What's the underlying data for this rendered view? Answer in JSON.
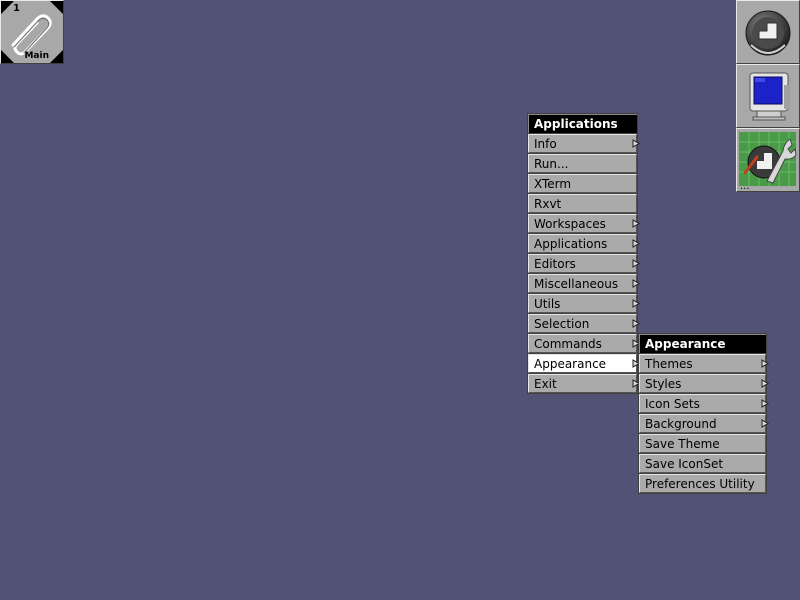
{
  "desktop": {
    "background": "#525275"
  },
  "clip": {
    "workspace_number": "1",
    "workspace_name": "Main",
    "icon": "paperclip-icon"
  },
  "dock": [
    {
      "name": "dock-wmaker-logo",
      "icon": "wmaker-logo-icon"
    },
    {
      "name": "dock-monitor",
      "icon": "monitor-icon"
    },
    {
      "name": "dock-wprefs",
      "icon": "preferences-wrench-icon",
      "ellipsis": "..."
    }
  ],
  "applications_menu": {
    "title": "Applications",
    "items": [
      {
        "label": "Info",
        "submenu": true
      },
      {
        "label": "Run...",
        "submenu": false
      },
      {
        "label": "XTerm",
        "submenu": false
      },
      {
        "label": "Rxvt",
        "submenu": false
      },
      {
        "label": "Workspaces",
        "submenu": true
      },
      {
        "label": "Applications",
        "submenu": true
      },
      {
        "label": "Editors",
        "submenu": true
      },
      {
        "label": "Miscellaneous",
        "submenu": true
      },
      {
        "label": "Utils",
        "submenu": true
      },
      {
        "label": "Selection",
        "submenu": true
      },
      {
        "label": "Commands",
        "submenu": true
      },
      {
        "label": "Appearance",
        "submenu": true,
        "active": true
      },
      {
        "label": "Exit",
        "submenu": true
      }
    ]
  },
  "appearance_menu": {
    "title": "Appearance",
    "items": [
      {
        "label": "Themes",
        "submenu": true
      },
      {
        "label": "Styles",
        "submenu": true
      },
      {
        "label": "Icon Sets",
        "submenu": true
      },
      {
        "label": "Background",
        "submenu": true
      },
      {
        "label": "Save Theme",
        "submenu": false
      },
      {
        "label": "Save IconSet",
        "submenu": false
      },
      {
        "label": "Preferences Utility",
        "submenu": false
      }
    ]
  }
}
